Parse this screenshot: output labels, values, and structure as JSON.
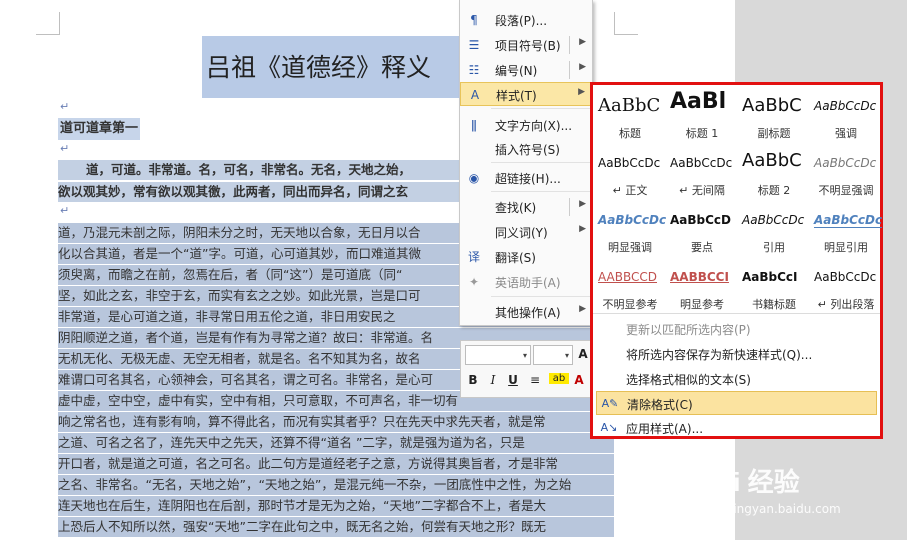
{
  "document": {
    "title": "吕祖《道德经》释义",
    "heading": "道可道章第一",
    "paragraph_mark": "↵",
    "lines": [
      "道，可道。非常道。名，可名，非常名。无名，天地之始，",
      "欲以观其妙，常有欲以观其徼，此两者，同出而异名，同谓之玄",
      "道，乃混元未剖之际，阴阳未分之时，无天地以合象，无日月以合",
      "化以合其道，者是一个“道”字。可道，心可道其妙，而口难道其微",
      "须臾离，而瞻之在前，忽焉在后，者（同“这”）是可道底（同“",
      "坚，如此之玄，非空于玄，而实有玄之之妙。如此光景，岂是口可",
      "非常道，是心可道之道，非寻常日用五伦之道，非日用安民之",
      "阴阳顺逆之道，者个道，岂是有作有为寻常之道？故曰：非常道。名",
      "无机无化、无极无虚、无空无相者，就是名。名不知其为名，故名",
      "难谓口可名其名，心领神会，可名其名，谓之可名。非常名，是心可",
      "虚中虚，空中空，虚中有实，空中有相，只可意取，不可声名，非一切有",
      "响之常名也，连有影有响，算不得此名，而况有实其者乎？只在先天中求先天者，就是常",
      "之道、可名之名了，连先天中之先天，还算不得“道名 ”二字，就是强为道为名，只是",
      "开口者，就是道之可道，名之可名。此二句方是道经老子之意，方说得其奥旨者，才是非常",
      "之名、非常名。“无名，天地之始”，“天地之始”，是混元纯一不杂，一团底性中之性，为之始",
      "连天地也在后生，连阴阳也在后剖，那时节才是无为之始，“天地”二字都合不上，者是大",
      "上恐后人不知所以然，强安“天地”二字在此句之中，既无名之始，何尝有天地之形？既无"
    ]
  },
  "context_menu": {
    "items": [
      {
        "icon": "paragraph-icon",
        "label": "段落(P)..."
      },
      {
        "icon": "bullets-icon",
        "label": "项目符号(B)",
        "submenu": true
      },
      {
        "icon": "numbering-icon",
        "label": "编号(N)",
        "submenu": true
      },
      {
        "icon": "styles-icon",
        "label": "样式(T)",
        "submenu": true
      },
      {
        "icon": "text-direction-icon",
        "label": "文字方向(X)..."
      },
      {
        "icon": "",
        "label": "插入符号(S)"
      },
      {
        "icon": "hyperlink-icon",
        "label": "超链接(H)..."
      },
      {
        "icon": "",
        "label": "查找(K)",
        "submenu": true
      },
      {
        "icon": "",
        "label": "同义词(Y)",
        "submenu": true
      },
      {
        "icon": "translate-icon",
        "label": "翻译(S)"
      },
      {
        "icon": "english-assistant-icon",
        "label": "英语助手(A)"
      },
      {
        "icon": "",
        "label": "其他操作(A)",
        "submenu": true
      }
    ]
  },
  "mini_toolbar": {
    "font_arrow": "▾",
    "size_arrow": "▾",
    "bold": "B",
    "italic": "I",
    "underline": "U",
    "align": "≡",
    "highlight": "ab",
    "font_color": "A",
    "grow": "A"
  },
  "styles_gallery": {
    "styles": [
      {
        "sample": "AaBbC",
        "name": "标题"
      },
      {
        "sample": "AaBl",
        "name": "标题 1"
      },
      {
        "sample": "AaBbC",
        "name": "副标题"
      },
      {
        "sample": "AaBbCcDc",
        "name": "强调"
      },
      {
        "sample": "AaBbCcDc",
        "name": "↵ 正文"
      },
      {
        "sample": "AaBbCcDc",
        "name": "↵ 无间隔"
      },
      {
        "sample": "AaBbC",
        "name": "标题 2"
      },
      {
        "sample": "AaBbCcDc",
        "name": "不明显强调"
      },
      {
        "sample": "AaBbCcDc",
        "name": "明显强调"
      },
      {
        "sample": "AaBbCcD",
        "name": "要点"
      },
      {
        "sample": "AaBbCcDc",
        "name": "引用"
      },
      {
        "sample": "AaBbCcDc",
        "name": "明显引用"
      },
      {
        "sample": "AABBCCD",
        "name": "不明显参考"
      },
      {
        "sample": "AABBCCI",
        "name": "明显参考"
      },
      {
        "sample": "AaBbCcI",
        "name": "书籍标题"
      },
      {
        "sample": "AaBbCcDc",
        "name": "↵ 列出段落"
      }
    ],
    "commands": [
      {
        "label": "更新以匹配所选内容(P)",
        "disabled": true
      },
      {
        "label": "将所选内容保存为新快速样式(Q)...",
        "disabled": false
      },
      {
        "label": "选择格式相似的文本(S)",
        "disabled": false
      },
      {
        "icon": "clear-formatting-icon",
        "label": "清除格式(C)",
        "disabled": false
      },
      {
        "icon": "apply-styles-icon",
        "label": "应用样式(A)...",
        "disabled": false
      }
    ]
  },
  "watermark": {
    "brand": "Bai 经验",
    "url": "jingyan.baidu.com"
  },
  "colors": {
    "selection": "#c7d5ea",
    "highlight_bar": "#b8c6dc",
    "menu_highlight": "#fbe7a6",
    "gallery_border": "#e21010"
  }
}
